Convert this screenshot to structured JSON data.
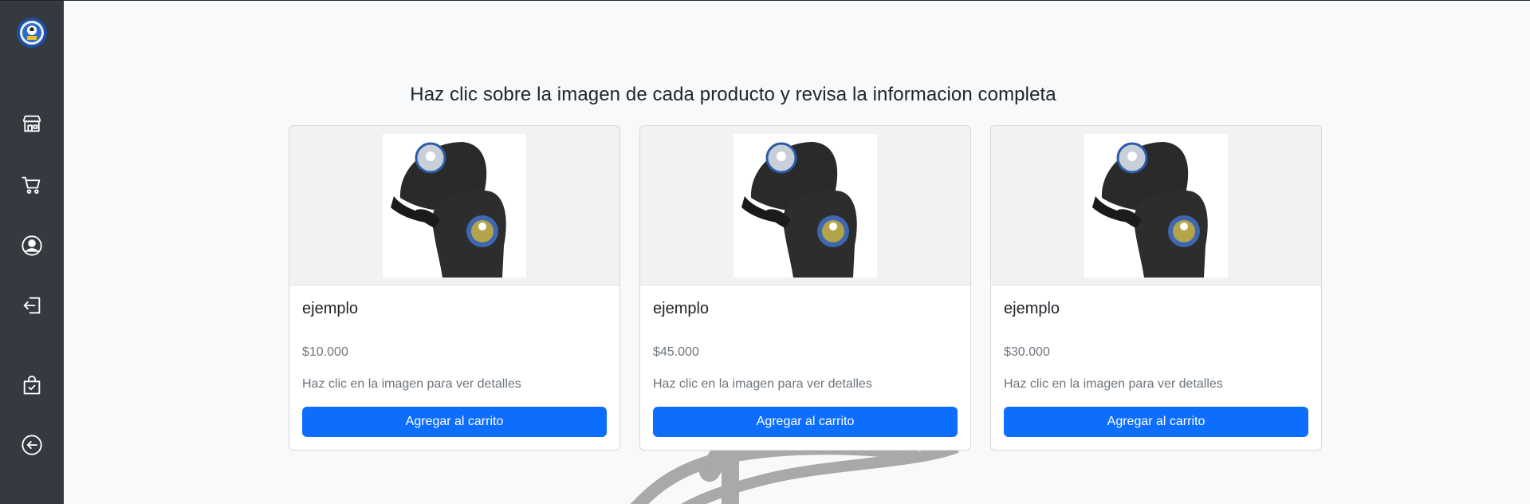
{
  "sidebar": {
    "logo": "club-logo",
    "items": [
      {
        "name": "store",
        "icon": "shop-icon"
      },
      {
        "name": "cart",
        "icon": "cart-icon"
      },
      {
        "name": "profile",
        "icon": "user-circle-icon"
      },
      {
        "name": "logout",
        "icon": "exit-door-icon"
      },
      {
        "name": "orders",
        "icon": "bag-check-icon"
      },
      {
        "name": "back",
        "icon": "arrow-left-circle-icon"
      }
    ]
  },
  "main": {
    "heading": "Haz clic sobre la imagen de cada producto y revisa la informacion completa",
    "products": [
      {
        "title": "ejemplo",
        "price": "$10.000",
        "hint": "Haz clic en la imagen para ver detalles",
        "button": "Agregar al carrito",
        "image": "black-caps-photo"
      },
      {
        "title": "ejemplo",
        "price": "$45.000",
        "hint": "Haz clic en la imagen para ver detalles",
        "button": "Agregar al carrito",
        "image": "black-caps-photo"
      },
      {
        "title": "ejemplo",
        "price": "$30.000",
        "hint": "Haz clic en la imagen para ver detalles",
        "button": "Agregar al carrito",
        "image": "black-caps-photo"
      }
    ]
  },
  "colors": {
    "sidebar_bg": "#343a40",
    "primary": "#0d6efd",
    "page_bg": "#f8f9fa"
  }
}
